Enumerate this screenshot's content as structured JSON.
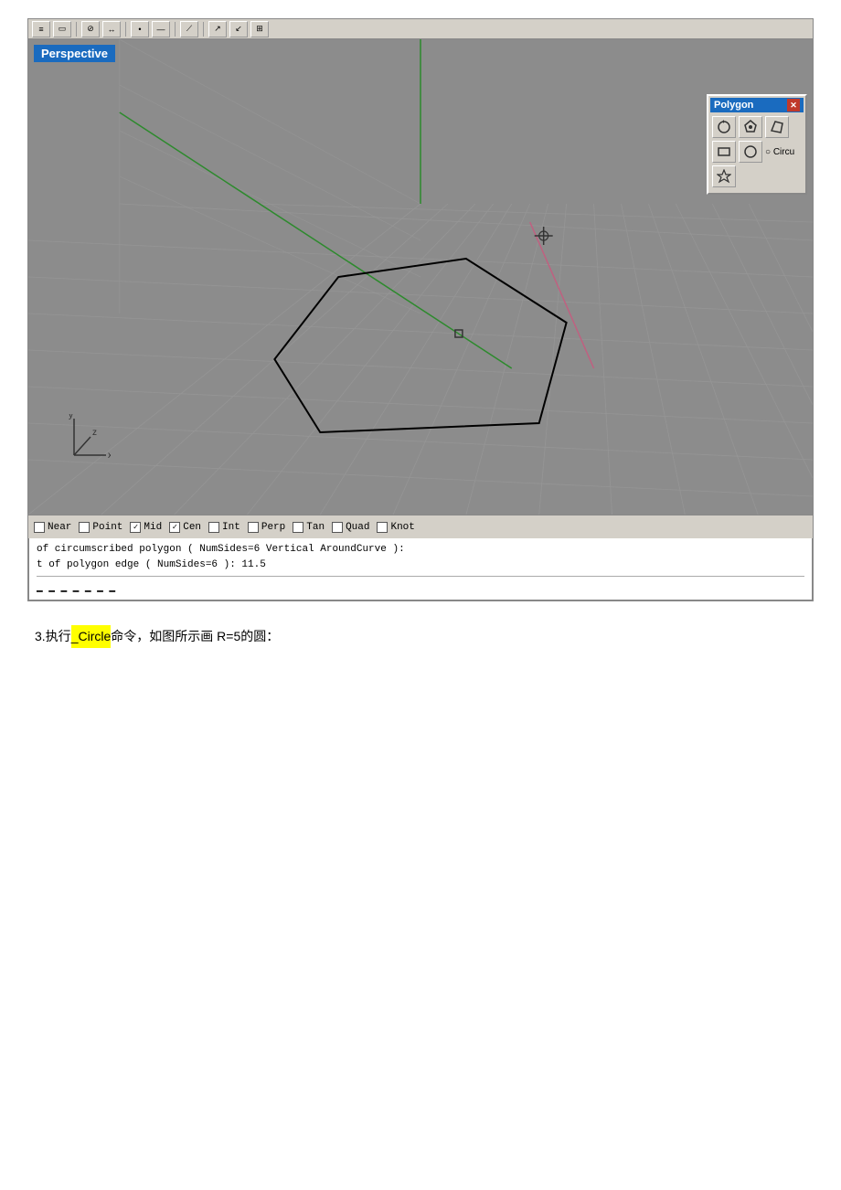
{
  "viewport": {
    "perspective_label": "Perspective",
    "background_color": "#8a8a8a",
    "grid_color_light": "#9a9a9a",
    "grid_color_dark": "#7a7a7a"
  },
  "polygon_panel": {
    "title": "Polygon",
    "close_label": "✕",
    "circle_label": "○ Circu"
  },
  "snap_toolbar": {
    "items": [
      {
        "label": "Near",
        "checked": false
      },
      {
        "label": "Point",
        "checked": false
      },
      {
        "label": "Mid",
        "checked": true
      },
      {
        "label": "Cen",
        "checked": true
      },
      {
        "label": "Int",
        "checked": false
      },
      {
        "label": "Perp",
        "checked": false
      },
      {
        "label": "Tan",
        "checked": false
      },
      {
        "label": "Quad",
        "checked": false
      },
      {
        "label": "Knot",
        "checked": false
      }
    ]
  },
  "command_lines": [
    "of circumscribed polygon ( NumSides=6  Vertical  AroundCurve ):",
    "t of polygon edge ( NumSides=6 ): 11.5"
  ],
  "instruction": {
    "number": "3.",
    "prefix": " 执行",
    "highlight": "_Circle",
    "suffix": " 命令，如图所示画 R=5的圆："
  }
}
